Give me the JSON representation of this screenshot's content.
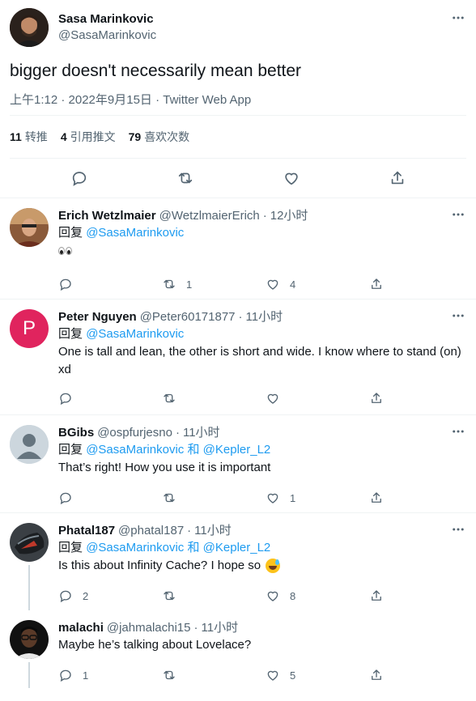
{
  "main_tweet": {
    "author_name": "Sasa Marinkovic",
    "author_handle": "@SasaMarinkovic",
    "text": "bigger doesn't necessarily mean better",
    "timestamp": "上午1:12 · 2022年9月15日 · Twitter Web App",
    "stats": {
      "retweets_count": "11",
      "retweets_label": "转推",
      "quotes_count": "4",
      "quotes_label": "引用推文",
      "likes_count": "79",
      "likes_label": "喜欢次数"
    }
  },
  "replies": [
    {
      "name": "Erich Wetzlmaier",
      "handle": "@WetzlmaierErich",
      "sep": "·",
      "time": "12小时",
      "replying_prefix": "回复",
      "mention1": "@SasaMarinkovic",
      "joiner": "",
      "mention2": "",
      "text": "",
      "replies": "",
      "retweets": "1",
      "likes": "4",
      "avatar_color": "#b87a4b"
    },
    {
      "name": "Peter Nguyen",
      "handle": "@Peter60171877",
      "sep": "·",
      "time": "11小时",
      "replying_prefix": "回复",
      "mention1": "@SasaMarinkovic",
      "joiner": "",
      "mention2": "",
      "text": "One is tall and lean, the other is short and wide. I know where to stand (on) xd",
      "replies": "",
      "retweets": "",
      "likes": "",
      "avatar_letter": "P",
      "avatar_color": "#e0245e"
    },
    {
      "name": "BGibs",
      "handle": "@ospfurjesno",
      "sep": "·",
      "time": "11小时",
      "replying_prefix": "回复",
      "mention1": "@SasaMarinkovic",
      "joiner": "和",
      "mention2": "@Kepler_L2",
      "text": "That’s right! How you use it is important",
      "replies": "",
      "retweets": "",
      "likes": "1",
      "avatar_color": "#ccd6dd"
    },
    {
      "name": "Phatal187",
      "handle": "@phatal187",
      "sep": "·",
      "time": "11小时",
      "replying_prefix": "回复",
      "mention1": "@SasaMarinkovic",
      "joiner": "和",
      "mention2": "@Kepler_L2",
      "text": "Is this about Infinity Cache? I hope so",
      "replies": "2",
      "retweets": "",
      "likes": "8",
      "avatar_color": "#2b2f33"
    },
    {
      "name": "malachi",
      "handle": "@jahmalachi15",
      "sep": "·",
      "time": "11小时",
      "text": "Maybe he’s talking about Lovelace?",
      "replies": "1",
      "retweets": "",
      "likes": "5",
      "avatar_color": "#1a1a1a"
    }
  ],
  "colors": {
    "link": "#1d9bf0",
    "secondary_text": "#536471",
    "divider": "#eff3f4",
    "thread_line": "#cfd9de"
  },
  "icons": [
    "more-icon",
    "reply-icon",
    "retweet-icon",
    "like-icon",
    "share-icon",
    "eyes-emoji-icon",
    "sweat-smile-emoji-icon"
  ]
}
